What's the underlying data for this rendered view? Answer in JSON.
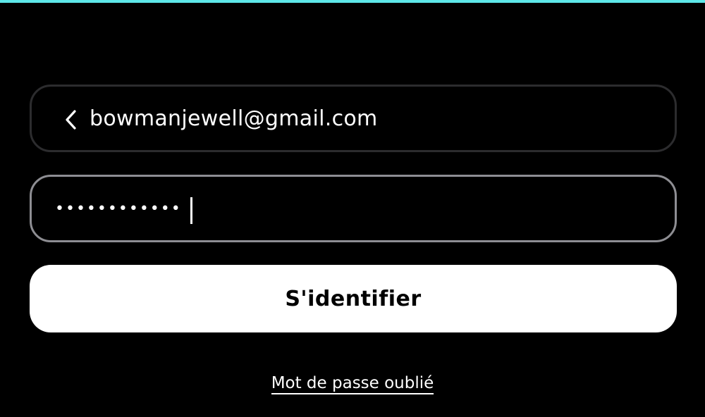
{
  "theme": {
    "accent": "#5ee7e9",
    "background": "#000000",
    "button_bg": "#ffffff"
  },
  "email": {
    "value": "bowmanjewell@gmail.com",
    "back_icon": "chevron-left-icon"
  },
  "password": {
    "masked_value": "••••••••••••"
  },
  "signin": {
    "label": "S'identifier"
  },
  "forgot": {
    "label": "Mot de passe oublié"
  }
}
